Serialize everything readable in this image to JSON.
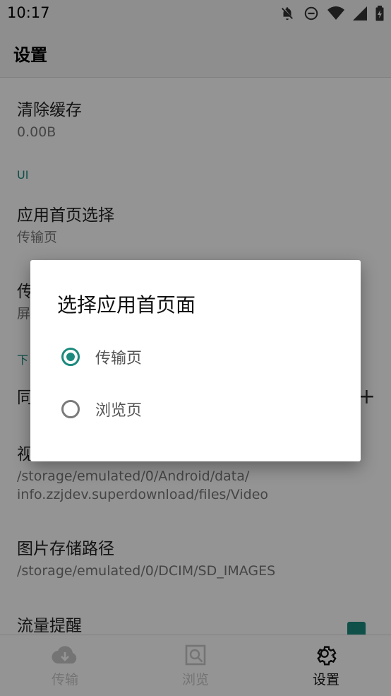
{
  "status_bar": {
    "time": "10:17"
  },
  "app_bar": {
    "title": "设置"
  },
  "settings": {
    "clear_cache": {
      "title": "清除缓存",
      "summary": "0.00B"
    },
    "category_ui": "UI",
    "home_page": {
      "title": "应用首页选择",
      "summary": "传输页"
    },
    "partial_1": {
      "title": "传",
      "summary": "屏"
    },
    "category_download": "下",
    "partial_2": {
      "title": "同"
    },
    "video_path": {
      "title": "视",
      "summary_line1": "/storage/emulated/0/Android/data/",
      "summary_line2": "info.zzjdev.superdownload/files/Video"
    },
    "image_path": {
      "title": "图片存储路径",
      "summary": "/storage/emulated/0/DCIM/SD_IMAGES"
    },
    "traffic_alert": {
      "title": "流量提醒",
      "checked": true
    }
  },
  "dialog": {
    "title": "选择应用首页面",
    "options": [
      {
        "label": "传输页",
        "selected": true
      },
      {
        "label": "浏览页",
        "selected": false
      }
    ]
  },
  "bottom_nav": {
    "items": [
      {
        "label": "传输",
        "icon": "cloud-download-icon",
        "active": false
      },
      {
        "label": "浏览",
        "icon": "browse-icon",
        "active": false
      },
      {
        "label": "设置",
        "icon": "gear-icon",
        "active": true
      }
    ]
  },
  "colors": {
    "accent": "#1b8a7e",
    "scrim": "rgba(0,0,0,0.42)"
  }
}
